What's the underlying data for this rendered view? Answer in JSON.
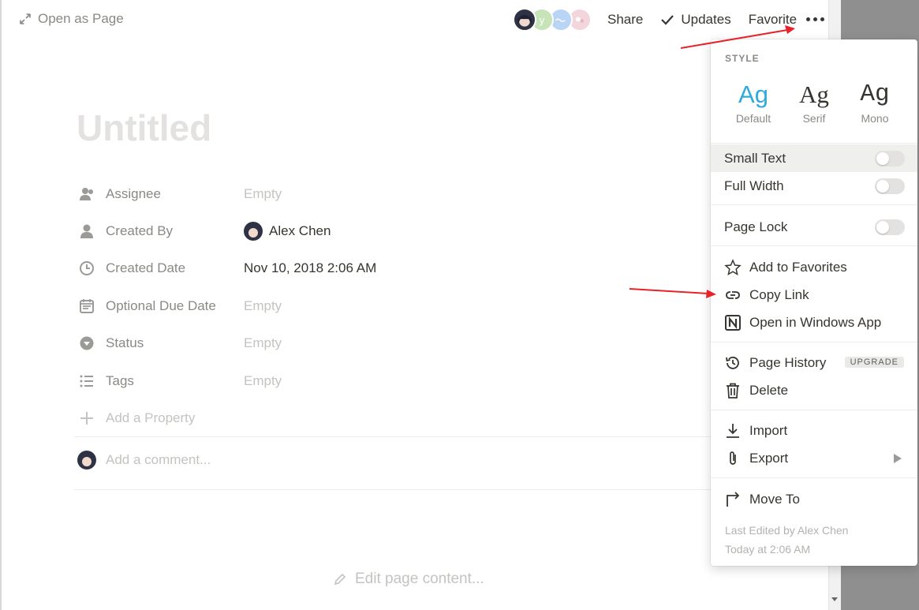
{
  "topbar": {
    "open_as_page": "Open as Page",
    "avatar_letter": "y",
    "share": "Share",
    "updates": "Updates",
    "favorite": "Favorite"
  },
  "page": {
    "title": "Untitled",
    "properties": [
      {
        "name": "Assignee",
        "value": "Empty",
        "icon": "assignee-icon"
      },
      {
        "name": "Created By",
        "value": "Alex Chen",
        "icon": "person-icon"
      },
      {
        "name": "Created Date",
        "value": "Nov 10, 2018 2:06 AM",
        "icon": "clock-icon"
      },
      {
        "name": "Optional Due Date",
        "value": "Empty",
        "icon": "calendar-icon"
      },
      {
        "name": "Status",
        "value": "Empty",
        "icon": "select-icon"
      },
      {
        "name": "Tags",
        "value": "Empty",
        "icon": "list-icon"
      }
    ],
    "add_property": "Add a Property",
    "comment_placeholder": "Add a comment...",
    "edit_content": "Edit page content..."
  },
  "menu": {
    "style_label": "STYLE",
    "styles": [
      {
        "glyph": "Ag",
        "label": "Default"
      },
      {
        "glyph": "Ag",
        "label": "Serif"
      },
      {
        "glyph": "Ag",
        "label": "Mono"
      }
    ],
    "small_text": "Small Text",
    "full_width": "Full Width",
    "page_lock": "Page Lock",
    "add_to_favorites": "Add to Favorites",
    "copy_link": "Copy Link",
    "open_in_windows_app": "Open in Windows App",
    "page_history": "Page History",
    "upgrade_badge": "UPGRADE",
    "delete": "Delete",
    "import": "Import",
    "export": "Export",
    "move_to": "Move To",
    "last_edited": "Last Edited by Alex Chen",
    "last_edited_time": "Today at 2:06 AM"
  },
  "colors": {
    "accent": "#2eaadc",
    "annotation_arrow": "#e8222a",
    "muted_text": "#c4c3c0"
  }
}
